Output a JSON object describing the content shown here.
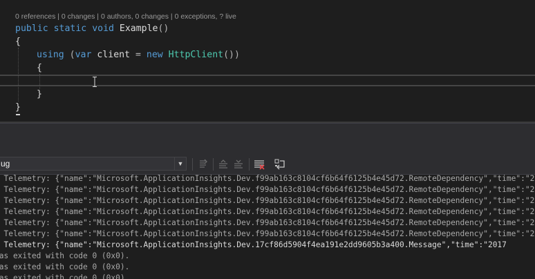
{
  "codelens": "0 references | 0 changes | 0 authors, 0 changes | 0 exceptions, ? live",
  "code": {
    "line1": {
      "kw1": "public",
      "kw2": "static",
      "kw3": "void",
      "name": "Example",
      "parens": "()"
    },
    "line2": "{",
    "line3": {
      "kw_using": "using",
      "open": "(",
      "kw_var": "var",
      "var_name": "client",
      "eq": "=",
      "kw_new": "new",
      "type": "HttpClient",
      "close": "())"
    },
    "line4": "{",
    "line6": "}",
    "line7": "}"
  },
  "output": {
    "source_selected": "ug",
    "lines": [
      "s Telemetry: {\"name\":\"Microsoft.ApplicationInsights.Dev.f99ab163c8104cf6b64f6125b4e45d72.RemoteDependency\",\"time\":\"2017",
      "s Telemetry: {\"name\":\"Microsoft.ApplicationInsights.Dev.f99ab163c8104cf6b64f6125b4e45d72.RemoteDependency\",\"time\":\"2017",
      "s Telemetry: {\"name\":\"Microsoft.ApplicationInsights.Dev.f99ab163c8104cf6b64f6125b4e45d72.RemoteDependency\",\"time\":\"2017",
      "s Telemetry: {\"name\":\"Microsoft.ApplicationInsights.Dev.f99ab163c8104cf6b64f6125b4e45d72.RemoteDependency\",\"time\":\"2017",
      "s Telemetry: {\"name\":\"Microsoft.ApplicationInsights.Dev.f99ab163c8104cf6b64f6125b4e45d72.RemoteDependency\",\"time\":\"2017",
      "s Telemetry: {\"name\":\"Microsoft.ApplicationInsights.Dev.f99ab163c8104cf6b64f6125b4e45d72.RemoteDependency\",\"time\":\"2017",
      "s Telemetry: {\"name\":\"Microsoft.ApplicationInsights.Dev.17cf86d5904f4ea191e2dd9605b3a400.Message\",\"time\":\"2017",
      "has exited with code 0 (0x0).",
      "has exited with code 0 (0x0).",
      "has exited with code 0 (0x0)."
    ]
  },
  "colors": {
    "keyword": "#569cd6",
    "type": "#4ec9b0",
    "text": "#dcdcdc",
    "output_text": "#a9a9a9",
    "editor_bg": "#1e1e1e",
    "toolbar_bg": "#2d2d30"
  },
  "icons": [
    "go-to-previous-message-icon",
    "find-message-up-icon",
    "find-message-down-icon",
    "clear-all-icon",
    "toggle-word-wrap-icon"
  ]
}
